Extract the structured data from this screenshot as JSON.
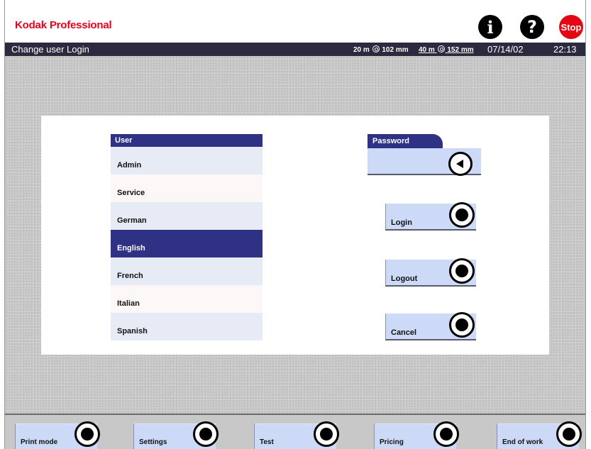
{
  "header": {
    "brand_kodak": "Kodak",
    "brand_professional": "Professional",
    "info_icon": "i",
    "help_icon": "?",
    "stop_label": "Stop"
  },
  "titlebar": {
    "title": "Change user Login",
    "roll1_length": "20 m",
    "roll1_width": "102 mm",
    "roll2_length": "40 m",
    "roll2_width": "152 mm",
    "date": "07/14/02",
    "time": "22:13"
  },
  "users": {
    "header": "User",
    "items": [
      "Admin",
      "Service",
      "German",
      "English",
      "French",
      "Italian",
      "Spanish"
    ],
    "selected": "English"
  },
  "password": {
    "label": "Password"
  },
  "actions": {
    "login": "Login",
    "logout": "Logout",
    "cancel": "Cancel"
  },
  "functions": [
    "Print mode",
    "Settings",
    "Test",
    "Pricing",
    "End of work"
  ],
  "colors": {
    "accent": "#2f3185",
    "button_face": "#ccd9f7",
    "brand_red": "#e30613",
    "titlebar": "#2c2a3f"
  }
}
